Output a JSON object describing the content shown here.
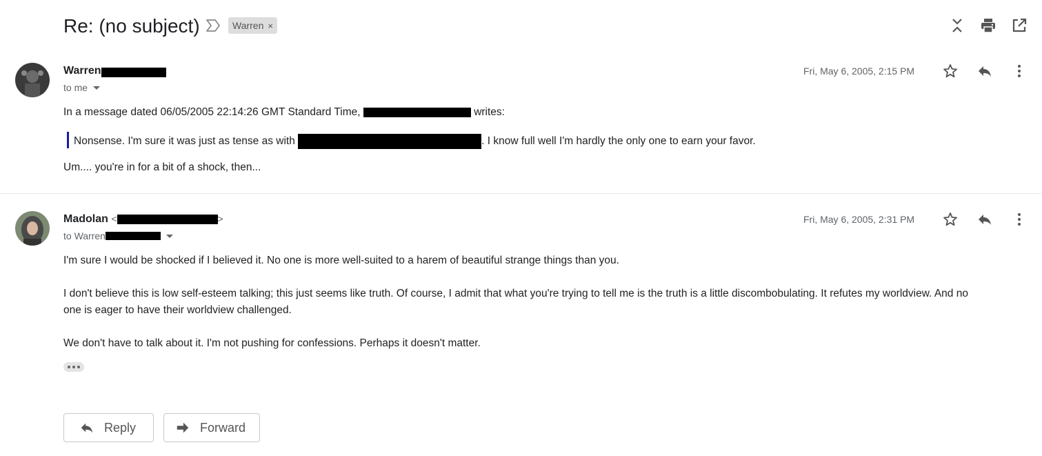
{
  "thread": {
    "subject": "Re: (no subject)",
    "label": "Warren",
    "label_remove": "×"
  },
  "messages": [
    {
      "sender_name": "Warren",
      "recipient_text": "to me",
      "date": "Fri, May 6, 2005, 2:15 PM",
      "body": {
        "intro_prefix": "In a message dated 06/05/2005 22:14:26 GMT Standard Time,",
        "intro_suffix": "writes:",
        "quote_prefix": "Nonsense. I'm sure it was just as tense as with",
        "quote_suffix": ". I know full well I'm hardly the only one to earn your favor.",
        "reply": "Um.... you're in for a bit of a shock, then..."
      }
    },
    {
      "sender_name": "Madolan",
      "sender_email_open": "<",
      "sender_email_close": ">",
      "recipient_text": "to Warren",
      "date": "Fri, May 6, 2005, 2:31 PM",
      "body": {
        "p1": "I'm sure I would be shocked if I believed it. No one is more well-suited to a harem of beautiful strange things than you.",
        "p2_line1": "I don't believe this is low self-esteem talking; this just seems like truth. Of course, I admit that what you're trying to tell me is the truth is a little discombobulating. It refutes my worldview. And no",
        "p2_line2": "one is eager to have their worldview challenged.",
        "p3": "We don't have to talk about it. I'm not pushing for confessions. Perhaps it doesn't matter."
      }
    }
  ],
  "actions": {
    "reply_label": "Reply",
    "forward_label": "Forward"
  },
  "colors": {
    "quote_bar": "#1a1aa6",
    "label_chip": "#dddddd",
    "icon_gray": "#5f6368"
  },
  "icons": {
    "header": [
      "importance-marker-icon",
      "collapse-all-icon",
      "print-icon",
      "open-in-new-window-icon"
    ],
    "message": [
      "star-icon",
      "reply-icon",
      "more-vert-icon"
    ]
  }
}
